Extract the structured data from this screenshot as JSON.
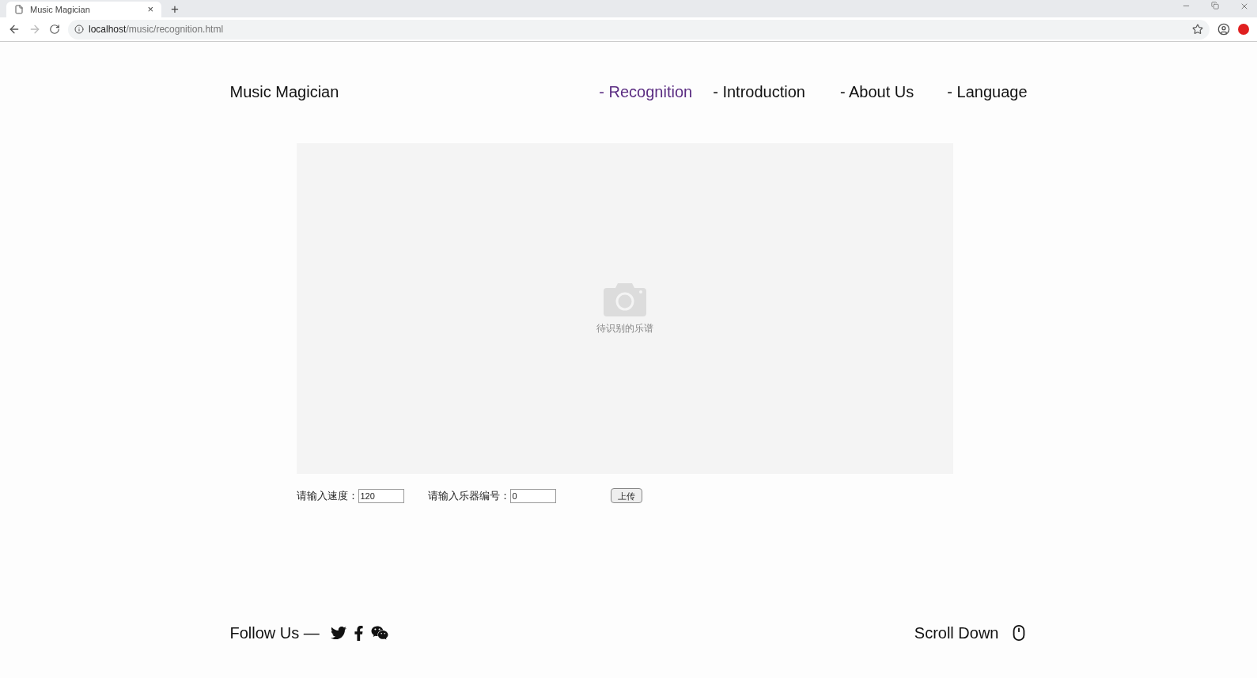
{
  "browser": {
    "tab_title": "Music Magician",
    "tab_close": "×",
    "new_tab": "+",
    "url_host": "localhost",
    "url_path": "/music/recognition.html"
  },
  "header": {
    "logo": "Music Magician",
    "nav": [
      {
        "label": "- Recognition",
        "selected": true
      },
      {
        "label": "- Introduction",
        "selected": false
      },
      {
        "label": "- About Us",
        "selected": false
      },
      {
        "label": "- Language",
        "selected": false
      }
    ]
  },
  "upload_area": {
    "caption": "待识别的乐谱"
  },
  "form": {
    "speed_label": "请输入速度：",
    "speed_value": "120",
    "instrument_label": "请输入乐器编号：",
    "instrument_value": "0",
    "upload_button": "上传"
  },
  "footer": {
    "follow": "Follow Us —",
    "scroll": "Scroll Down"
  }
}
